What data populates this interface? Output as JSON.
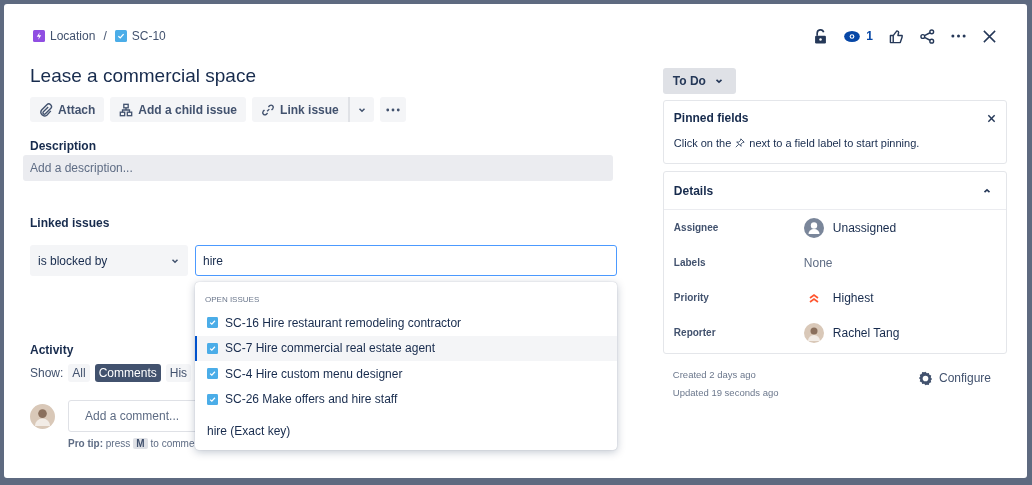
{
  "breadcrumb": [
    {
      "label": "Location",
      "kind": "epic"
    },
    {
      "label": "SC-10",
      "kind": "task"
    }
  ],
  "separator": "/",
  "watchers": "1",
  "title": "Lease a commercial space",
  "actions": [
    {
      "label": "Attach",
      "kind": "attach"
    },
    {
      "label": "Add a child issue",
      "kind": "child"
    },
    {
      "label": "Link issue",
      "kind": "link"
    }
  ],
  "description": {
    "label": "Description",
    "placeholder": "Add a description..."
  },
  "linked_issues": {
    "label": "Linked issues",
    "relation": "is blocked by",
    "query": "hire",
    "heading": "OPEN ISSUES",
    "items": [
      {
        "label": "SC-16 Hire restaurant remodeling contractor",
        "selected": false
      },
      {
        "label": "SC-7 Hire commercial real estate agent",
        "selected": true
      },
      {
        "label": "SC-4 Hire custom menu designer",
        "selected": false
      },
      {
        "label": "SC-26 Make offers and hire staff",
        "selected": false
      }
    ],
    "exact_key": "hire (Exact key)"
  },
  "activity": {
    "label": "Activity",
    "show_label": "Show:",
    "filters": [
      {
        "label": "All",
        "selected": false
      },
      {
        "label": "Comments",
        "selected": true
      },
      {
        "label": "His",
        "selected": false
      }
    ],
    "comment_placeholder": "Add a comment...",
    "tip": "**Pro tip:** press",
    "tip_key": "M",
    "tip_rest": "to comme"
  },
  "status": "To Do",
  "pinned": {
    "title": "Pinned fields",
    "text_before": "Click on the",
    "text_after": "next to a field label to start pinning."
  },
  "details": {
    "title": "Details",
    "expanded": true,
    "fields": [
      {
        "label": "Assignee",
        "value": "Unassigned",
        "kind": "unassigned"
      },
      {
        "label": "Labels",
        "value": "None",
        "kind": "none"
      },
      {
        "label": "Priority",
        "value": "Highest",
        "kind": "priority"
      },
      {
        "label": "Reporter",
        "value": "Rachel Tang",
        "kind": "person"
      }
    ]
  },
  "created": "Created 2 days ago",
  "updated": "Updated 19 seconds ago",
  "configure": "Configure"
}
